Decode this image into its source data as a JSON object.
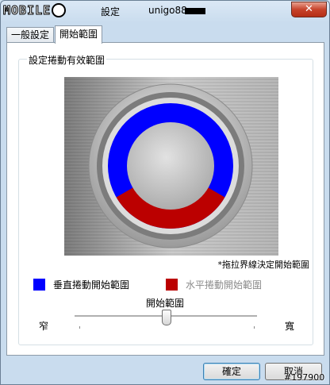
{
  "window": {
    "logo_text": "MOBILE",
    "title": "設定",
    "user": "unigo88",
    "close_glyph": "✕"
  },
  "tabs": [
    {
      "label": "一般設定",
      "active": false
    },
    {
      "label": "開始範圍",
      "active": true
    }
  ],
  "group": {
    "title": "設定捲動有效範圍",
    "hint": "*拖拉界線決定開始範圍"
  },
  "legend": {
    "vertical": {
      "label": "垂直捲動開始範圍",
      "color": "#0000ff"
    },
    "horizontal": {
      "label": "水平捲動開始範圍",
      "color": "#bb0000"
    }
  },
  "slider": {
    "label": "開始範圍",
    "min_label": "窄",
    "max_label": "寬",
    "value_fraction": 0.5
  },
  "buttons": {
    "ok": "確定",
    "cancel": "取消"
  },
  "watermark": "#197900"
}
